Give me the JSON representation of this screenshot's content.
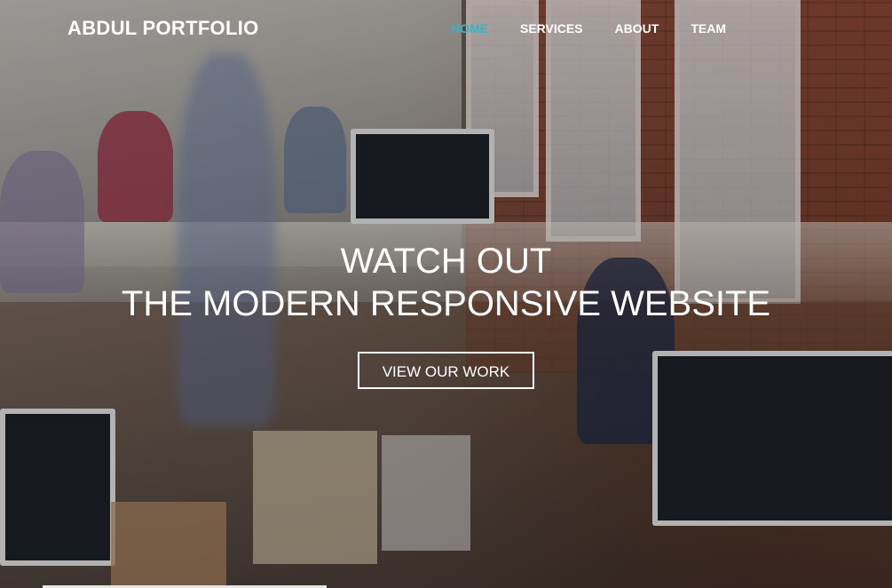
{
  "brand": {
    "name": "ABDUL PORTFOLIO"
  },
  "nav": {
    "items": [
      {
        "label": "HOME",
        "active": true
      },
      {
        "label": "SERVICES",
        "active": false
      },
      {
        "label": "ABOUT",
        "active": false
      },
      {
        "label": "TEAM",
        "active": false
      }
    ]
  },
  "hero": {
    "headline_line1": "WATCH OUT",
    "headline_line2": "THE MODERN RESPONSIVE WEBSITE",
    "cta_label": "VIEW OUR WORK",
    "background_image": "office-workspace-photo"
  },
  "colors": {
    "accent": "#36b5c6",
    "text": "#ffffff"
  }
}
